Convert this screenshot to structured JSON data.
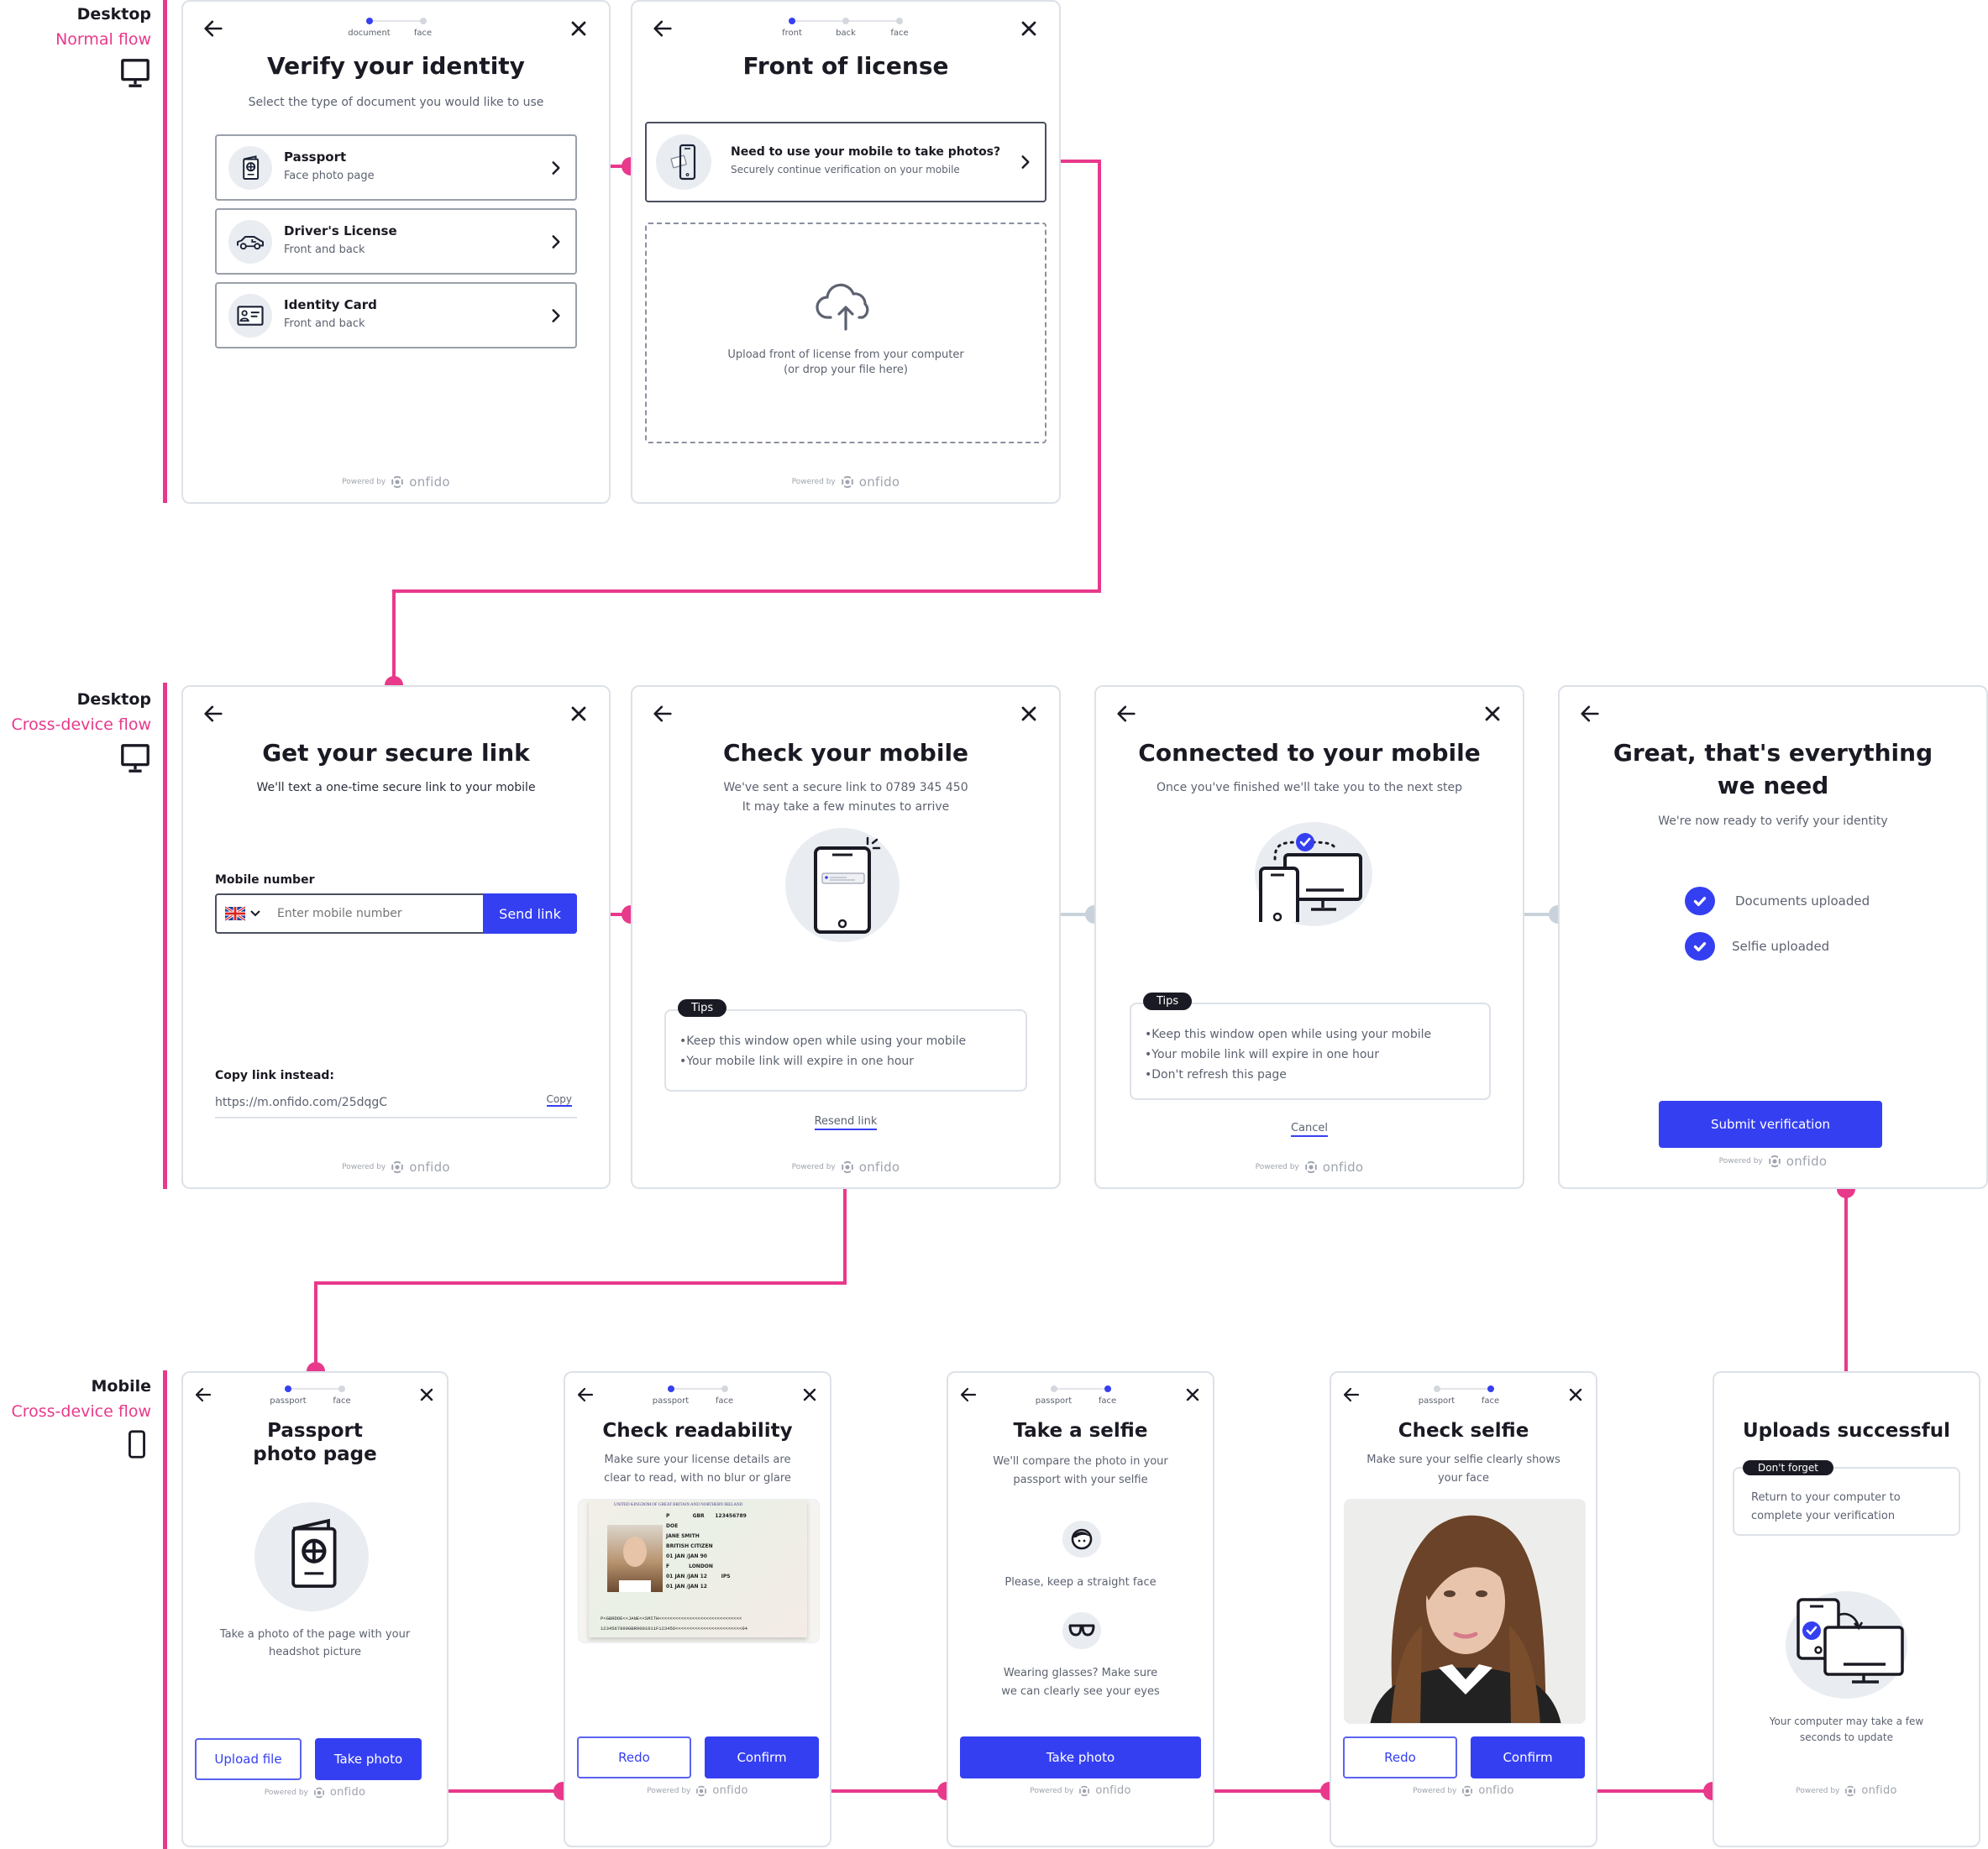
{
  "colors": {
    "accent": "#e8398b",
    "primary": "#353ff2",
    "text": "#1a1a24",
    "muted": "#5c6270",
    "border": "#dde1e8",
    "connector_inactive": "#c9d2db"
  },
  "brand": {
    "powered_by": "Powered by",
    "name": "onfido",
    "logo_icon": "onfido-logo-icon"
  },
  "rows": [
    {
      "device": "Desktop",
      "flow": "Normal flow",
      "icon": "desktop-monitor-icon"
    },
    {
      "device": "Desktop",
      "flow": "Cross-device flow",
      "icon": "desktop-monitor-icon"
    },
    {
      "device": "Mobile",
      "flow": "Cross-device flow",
      "icon": "mobile-phone-icon"
    }
  ],
  "screens": {
    "verify_identity": {
      "steps": [
        "document",
        "face"
      ],
      "active_step": 0,
      "title": "Verify your identity",
      "subtitle": "Select the type of document you would like to use",
      "options": [
        {
          "label": "Passport",
          "sub": "Face photo page",
          "icon": "passport-icon"
        },
        {
          "label": "Driver's License",
          "sub": "Front and back",
          "icon": "car-icon"
        },
        {
          "label": "Identity Card",
          "sub": "Front and back",
          "icon": "id-card-icon"
        }
      ]
    },
    "front_of_license": {
      "steps": [
        "front",
        "back",
        "face"
      ],
      "active_step": 0,
      "title": "Front of license",
      "mobile_option": {
        "label": "Need to use your mobile to take photos?",
        "sub": "Securely continue verification on your mobile"
      },
      "upload_line1": "Upload front of license from your computer",
      "upload_line2": "(or drop your file here)"
    },
    "secure_link": {
      "title": "Get your secure link",
      "subtitle": "We'll text a one-time secure link to your mobile",
      "mobile_label": "Mobile number",
      "country_flag": "uk-flag-icon",
      "mobile_placeholder": "Enter mobile number",
      "mobile_value": "",
      "send_button": "Send link",
      "copy_label": "Copy link instead:",
      "copy_url": "https://m.onfido.com/25dqgC",
      "copy_button": "Copy"
    },
    "check_mobile": {
      "title": "Check your mobile",
      "subtitle_line1": "We've sent a secure link to 0789 345 450",
      "subtitle_line2": "It may take a few minutes to arrive",
      "tips_badge": "Tips",
      "tips": [
        "Keep this window open while using your mobile",
        "Your mobile link will expire in one hour"
      ],
      "link": "Resend link"
    },
    "connected": {
      "title": "Connected to your mobile",
      "subtitle": "Once you've finished we'll take you to the next step",
      "tips_badge": "Tips",
      "tips": [
        "Keep this window open while using your mobile",
        "Your mobile link will expire in one hour",
        "Don't refresh this page"
      ],
      "link": "Cancel"
    },
    "complete": {
      "title_line1": "Great, that's everything",
      "title_line2": "we need",
      "subtitle": "We're now ready to verify your identity",
      "checks": [
        "Documents uploaded",
        "Selfie uploaded"
      ],
      "submit_button": "Submit verification"
    },
    "passport_photo": {
      "steps": [
        "passport",
        "face"
      ],
      "active_step": 0,
      "title_line1": "Passport",
      "title_line2": "photo page",
      "desc_line1": "Take a photo of the page with your",
      "desc_line2": "headshot picture",
      "upload_button": "Upload file",
      "take_button": "Take photo"
    },
    "check_readability": {
      "steps": [
        "passport",
        "face"
      ],
      "active_step": 0,
      "title": "Check readability",
      "desc_line1": "Make sure your license details are",
      "desc_line2": "clear to read, with no blur or glare",
      "passport": {
        "header": "UNITED KINGDOM OF GREAT BRITAIN AND NORTHERN IRELAND",
        "type": "P",
        "code": "GBR",
        "number": "123456789",
        "surname": "DOE",
        "given": "JANE SMITH",
        "nationality": "BRITISH CITIZEN",
        "dob": "01 JAN /JAN 90",
        "sex": "F",
        "place": "LONDON",
        "issue": "01  JAN /JAN 12",
        "authority": "IPS",
        "expiry": "01  JAN /JAN 12",
        "mrz1": "P<GBRDOE<<JANE<<SMITH<<<<<<<<<<<<<<<<<<<<<<<<<<<<<<",
        "mrz2": "1234567890GBR9001011F123456<<<<<<<<<<<<<<<<<<<<<<<<04"
      },
      "redo_button": "Redo",
      "confirm_button": "Confirm"
    },
    "take_selfie": {
      "steps": [
        "passport",
        "face"
      ],
      "active_step": 1,
      "title": "Take a selfie",
      "desc_line1": "We'll compare the photo in your",
      "desc_line2": "passport with your selfie",
      "hint1": "Please, keep a straight face",
      "hint2_line1": "Wearing glasses? Make sure",
      "hint2_line2": "we can clearly see your eyes",
      "take_button": "Take photo"
    },
    "check_selfie": {
      "steps": [
        "passport",
        "face"
      ],
      "active_step": 1,
      "title": "Check selfie",
      "desc_line1": "Make sure your selfie clearly shows",
      "desc_line2": "your face",
      "redo_button": "Redo",
      "confirm_button": "Confirm"
    },
    "uploads_success": {
      "title": "Uploads successful",
      "badge": "Don't forget",
      "note_line1": "Return to your computer to",
      "note_line2": "complete your verification",
      "footer_line1": "Your computer may take a few",
      "footer_line2": "seconds to update"
    }
  }
}
